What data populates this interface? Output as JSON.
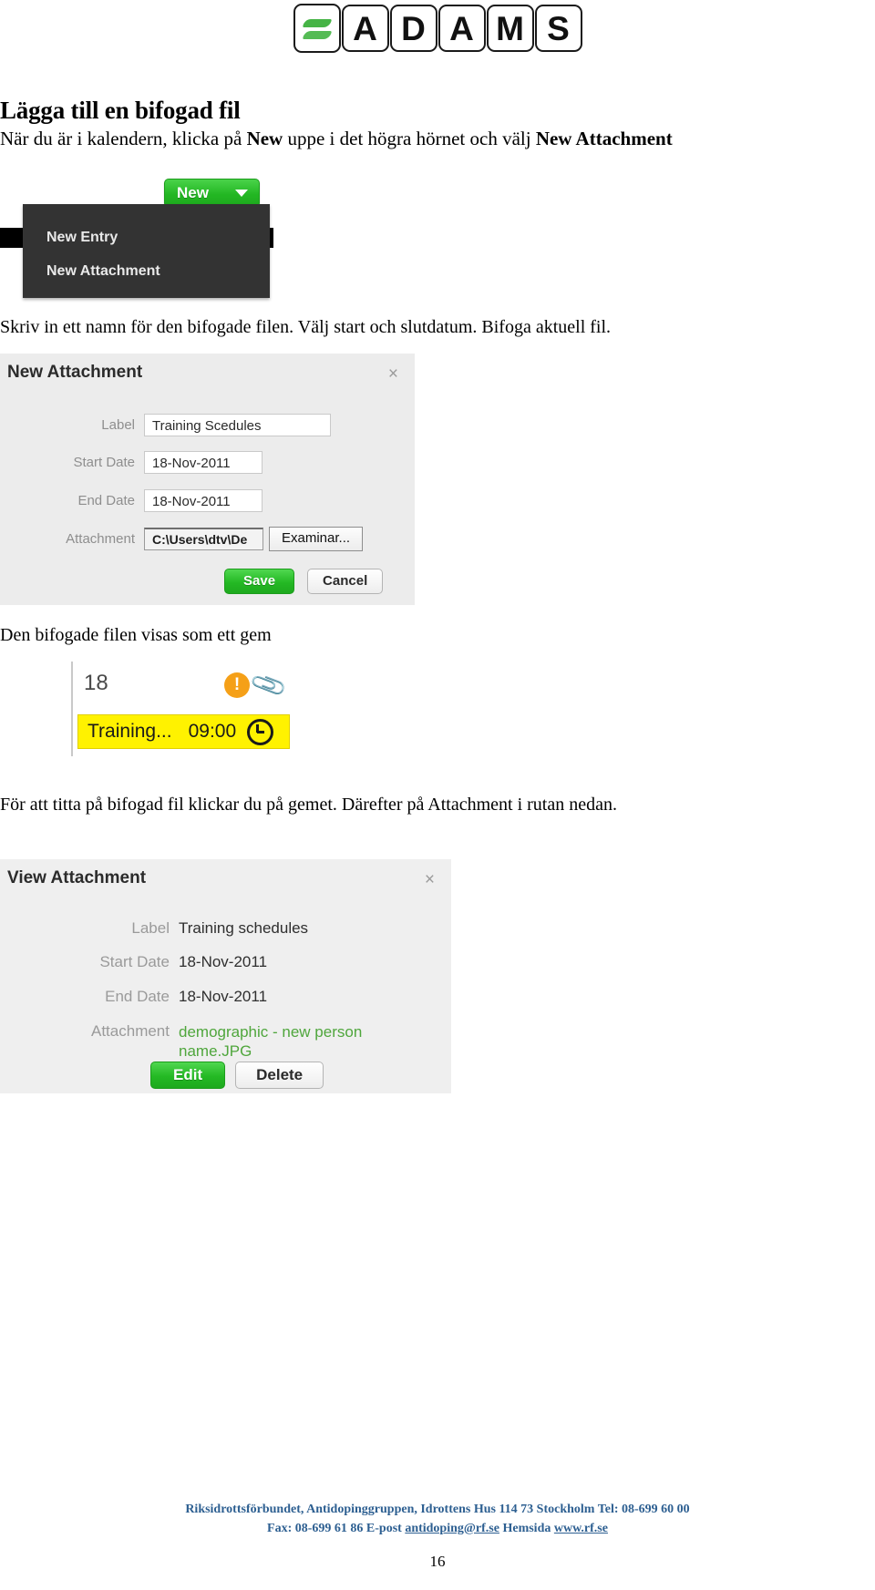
{
  "logo": {
    "tiles": [
      "leaf",
      "A",
      "D",
      "A",
      "M",
      "S"
    ],
    "leaf_color": "#46b446"
  },
  "heading": {
    "title": "Lägga till en bifogad fil",
    "intro_part1": "När du är i kalendern, klicka på ",
    "intro_bold1": "New",
    "intro_part2": " uppe i det högra hörnet och välj ",
    "intro_bold2": "New Attachment"
  },
  "paragraphs": {
    "skriv": "Skriv in ett namn för den bifogade filen. Välj start och slutdatum. Bifoga aktuell fil.",
    "gem": "Den bifogade filen visas som ett gem",
    "view": "För att titta på bifogad fil klickar du på gemet. Därefter på Attachment i rutan nedan."
  },
  "new_menu": {
    "button_label": "New",
    "caret": "chevron-down-icon",
    "items": [
      "New Entry",
      "New Attachment"
    ]
  },
  "new_attachment_dialog": {
    "title": "New Attachment",
    "close": "×",
    "fields": [
      {
        "label": "Label",
        "value": "Training Scedules"
      },
      {
        "label": "Start Date",
        "value": "18-Nov-2011"
      },
      {
        "label": "End Date",
        "value": "18-Nov-2011"
      },
      {
        "label": "Attachment",
        "value": "C:\\Users\\dtv\\De"
      }
    ],
    "browse_button": "Examinar...",
    "save_button": "Save",
    "cancel_button": "Cancel"
  },
  "calendar_cell": {
    "day_number": "18",
    "warning_icon": "!",
    "clip_icon": "📎",
    "event_name": "Training...",
    "event_time": "09:00"
  },
  "view_attachment_dialog": {
    "title": "View Attachment",
    "close": "×",
    "fields": [
      {
        "label": "Label",
        "value": "Training schedules"
      },
      {
        "label": "Start Date",
        "value": "18-Nov-2011"
      },
      {
        "label": "End Date",
        "value": "18-Nov-2011"
      },
      {
        "label": "Attachment",
        "value": "demographic - new person name.JPG"
      }
    ],
    "edit_button": "Edit",
    "delete_button": "Delete"
  },
  "footer": {
    "line1": "Riksidrottsförbundet, Antidopinggruppen, Idrottens Hus 114 73 Stockholm Tel: 08-699 60 00",
    "line2_pre": "Fax: 08-699 61 86 E-post ",
    "line2_email": "antidoping@rf.se",
    "line2_mid": " Hemsida ",
    "line2_site": "www.rf.se",
    "page_number": "16"
  }
}
